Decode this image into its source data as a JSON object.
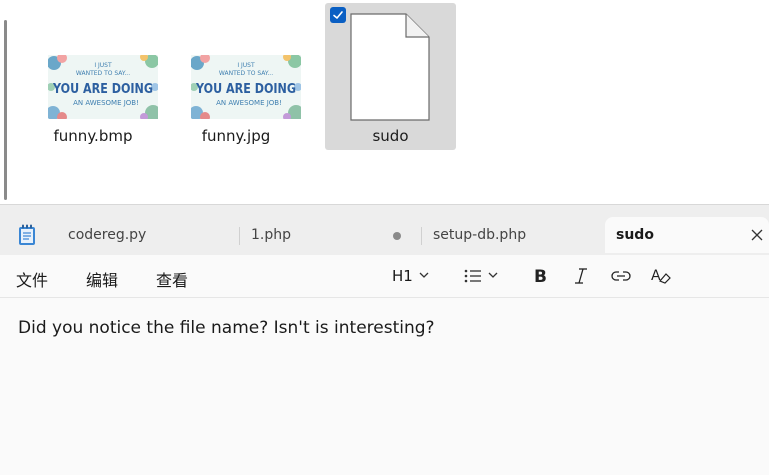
{
  "explorer": {
    "files": [
      {
        "name": "funny.bmp",
        "type": "image",
        "thumb": {
          "line1": "I JUST",
          "line2": "WANTED TO SAY...",
          "line3": "YOU ARE DOING",
          "line4": "AN AWESOME JOB!"
        }
      },
      {
        "name": "funny.jpg",
        "type": "image",
        "thumb": {
          "line1": "I JUST",
          "line2": "WANTED TO SAY...",
          "line3": "YOU ARE DOING",
          "line4": "AN AWESOME JOB!"
        }
      },
      {
        "name": "sudo",
        "type": "generic-file",
        "selected": true
      }
    ]
  },
  "notepad": {
    "tabs": [
      {
        "label": "codereg.py"
      },
      {
        "label": "1.php",
        "unsaved": true
      },
      {
        "label": "setup-db.php"
      },
      {
        "label": "sudo",
        "active": true
      }
    ],
    "menu": {
      "file": "文件",
      "edit": "编辑",
      "view": "查看"
    },
    "toolbar": {
      "heading": "H1"
    },
    "content": "Did you notice the file name? Isn't is interesting?"
  },
  "colors": {
    "accent": "#0a5fc3",
    "selection": "#d9d9d9"
  }
}
